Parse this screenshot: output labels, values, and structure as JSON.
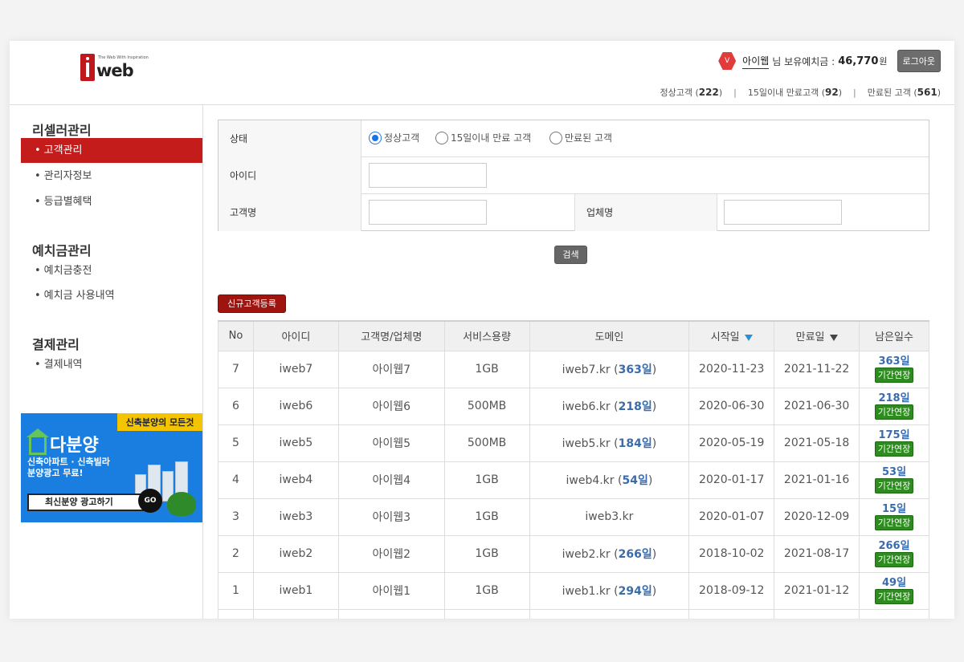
{
  "header": {
    "logo_tagline": "The Web With Inspiration",
    "logo_word": "web",
    "grade_badge": "V",
    "user_name": "아이웹",
    "user_suffix": "님 보유예치금 :",
    "balance": "46,770",
    "currency": "원",
    "logout_label": "로그아웃",
    "counts": [
      {
        "label": "정상고객",
        "value": "222"
      },
      {
        "label": "15일이내 만료고객",
        "value": "92"
      },
      {
        "label": "만료된 고객",
        "value": "561"
      }
    ]
  },
  "sidebar": {
    "sections": [
      {
        "title": "리셀러관리",
        "items": [
          "고객관리",
          "관리자정보",
          "등급별혜택"
        ]
      },
      {
        "title": "예치금관리",
        "items": [
          "예치금충전",
          "예치금 사용내역"
        ]
      },
      {
        "title": "결제관리",
        "items": [
          "결제내역"
        ]
      }
    ],
    "active_item": "고객관리",
    "banner": {
      "tag": "신축분양의 모든것",
      "brand": "다분양",
      "line1": "신축아파트 · 신축빌라",
      "line2": "분양광고 무료!",
      "cta": "최신분양 광고하기",
      "go": "GO"
    }
  },
  "search": {
    "status_label": "상태",
    "status_options": [
      "정상고객",
      "15일이내 만료 고객",
      "만료된 고객"
    ],
    "status_selected": "정상고객",
    "id_label": "아이디",
    "id_value": "",
    "name_label": "고객명",
    "name_value": "",
    "company_label": "업체명",
    "company_value": "",
    "search_button": "검색",
    "register_button": "신규고객등록"
  },
  "table": {
    "headers": [
      "No",
      "아이디",
      "고객명/업체명",
      "서비스용량",
      "도메인",
      "시작일",
      "만료일",
      "남은일수"
    ],
    "extend_label": "기간연장",
    "rows": [
      {
        "no": "7",
        "id": "iweb7",
        "name": "아이웹7",
        "capacity": "1GB",
        "domain": "iweb7.kr",
        "domain_days": "363일",
        "start": "2020-11-23",
        "end": "2021-11-22",
        "remaining": "363일"
      },
      {
        "no": "6",
        "id": "iweb6",
        "name": "아이웹6",
        "capacity": "500MB",
        "domain": "iweb6.kr",
        "domain_days": "218일",
        "start": "2020-06-30",
        "end": "2021-06-30",
        "remaining": "218일"
      },
      {
        "no": "5",
        "id": "iweb5",
        "name": "아이웹5",
        "capacity": "500MB",
        "domain": "iweb5.kr",
        "domain_days": "184일",
        "start": "2020-05-19",
        "end": "2021-05-18",
        "remaining": "175일"
      },
      {
        "no": "4",
        "id": "iweb4",
        "name": "아이웹4",
        "capacity": "1GB",
        "domain": "iweb4.kr",
        "domain_days": "54일",
        "start": "2020-01-17",
        "end": "2021-01-16",
        "remaining": "53일"
      },
      {
        "no": "3",
        "id": "iweb3",
        "name": "아이웹3",
        "capacity": "1GB",
        "domain": "iweb3.kr",
        "domain_days": "",
        "start": "2020-01-07",
        "end": "2020-12-09",
        "remaining": "15일"
      },
      {
        "no": "2",
        "id": "iweb2",
        "name": "아이웹2",
        "capacity": "1GB",
        "domain": "iweb2.kr",
        "domain_days": "266일",
        "start": "2018-10-02",
        "end": "2021-08-17",
        "remaining": "266일"
      },
      {
        "no": "1",
        "id": "iweb1",
        "name": "아이웹1",
        "capacity": "1GB",
        "domain": "iweb1.kr",
        "domain_days": "294일",
        "start": "2018-09-12",
        "end": "2021-01-12",
        "remaining": "49일"
      }
    ]
  }
}
